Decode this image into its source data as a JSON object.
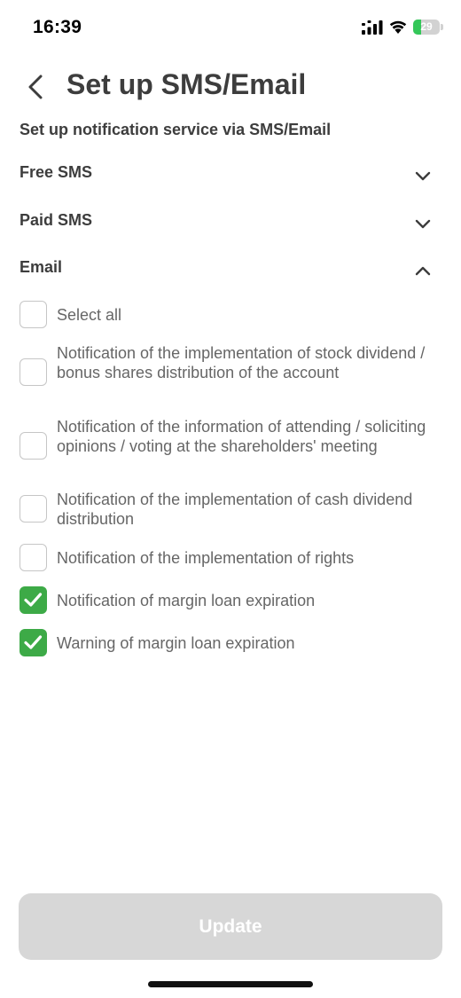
{
  "status_bar": {
    "time": "16:39",
    "battery_percent": "29",
    "battery_level": 0.29,
    "battery_color": "#34c759"
  },
  "header": {
    "back_icon": "chevron-left-icon",
    "title": "Set up SMS/Email",
    "subtitle": "Set up notification service via SMS/Email"
  },
  "sections": [
    {
      "label": "Free SMS",
      "expanded": false,
      "icon": "chevron-down-icon"
    },
    {
      "label": "Paid SMS",
      "expanded": false,
      "icon": "chevron-down-icon"
    },
    {
      "label": "Email",
      "expanded": true,
      "icon": "chevron-up-icon"
    }
  ],
  "email_options": {
    "select_all": {
      "label": "Select all",
      "checked": false
    },
    "items": [
      {
        "label": "Notification of the implementation of stock dividend / bonus shares distribution of the account",
        "checked": false
      },
      {
        "label": "Notification of the information of attending / soliciting opinions / voting at the shareholders' meeting",
        "checked": false
      },
      {
        "label": "Notification of the implementation of cash dividend distribution",
        "checked": false
      },
      {
        "label": "Notification of the implementation of rights",
        "checked": false
      },
      {
        "label": "Notification of margin loan expiration",
        "checked": true
      },
      {
        "label": "Warning of margin loan expiration",
        "checked": true
      }
    ]
  },
  "footer": {
    "update_label": "Update",
    "update_enabled": false
  },
  "colors": {
    "accent": "#3daa47",
    "text_primary": "#3d3d3d",
    "text_secondary": "#666666",
    "button_disabled": "#d7d7d7"
  }
}
